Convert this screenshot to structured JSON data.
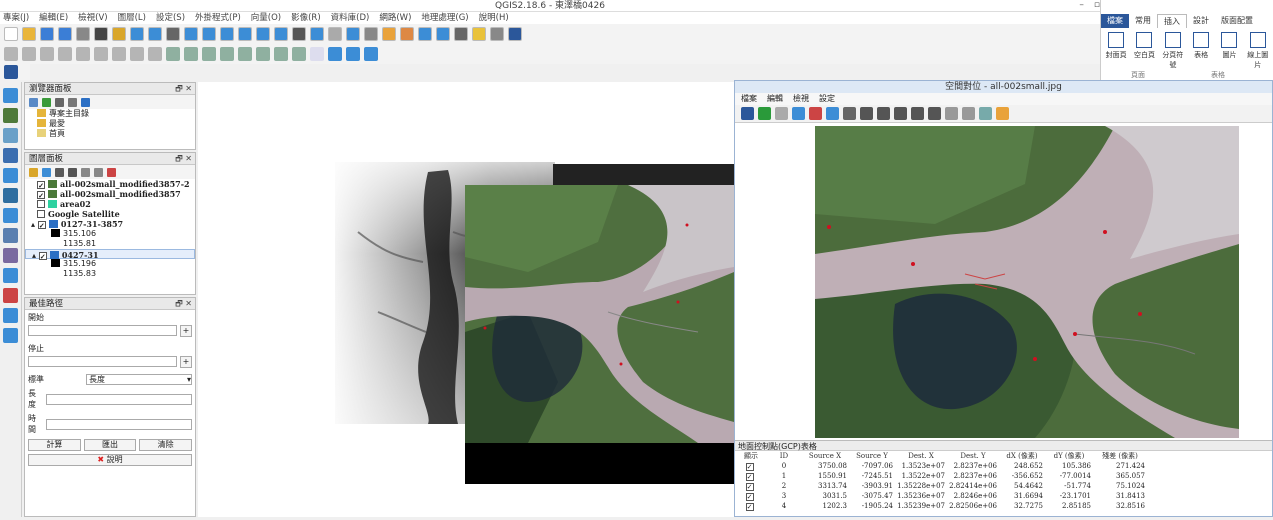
{
  "window": {
    "title": "QGIS2.18.6 - 東澤橋0426"
  },
  "menubar": [
    "專案(J)",
    "編輯(E)",
    "檢視(V)",
    "圖層(L)",
    "設定(S)",
    "外掛程式(P)",
    "向量(O)",
    "影像(R)",
    "資料庫(D)",
    "網路(W)",
    "地理處理(G)",
    "說明(H)"
  ],
  "browser_panel": {
    "title": "瀏覽器面板",
    "items": [
      "專案主目錄",
      "最愛",
      "首頁"
    ]
  },
  "layers_panel": {
    "title": "圖層面板",
    "layers": [
      {
        "name": "all-002small_modified3857-2",
        "checked": "✓"
      },
      {
        "name": "all-002small_modified3857",
        "checked": "✓"
      },
      {
        "name": "area02",
        "checked": ""
      },
      {
        "name": "Google Satellite",
        "checked": ""
      },
      {
        "name": "0127-31-3857",
        "checked": "✓"
      },
      {
        "name": "0427-31",
        "checked": "✓"
      }
    ],
    "legend_values": [
      "315.106",
      "1135.81",
      "315.196",
      "1135.83"
    ]
  },
  "measure_panel": {
    "title": "最佳路徑",
    "start_label": "開始",
    "stop_label": "停止",
    "criterion_label": "標準",
    "criterion_value": "長度",
    "length_label": "長度",
    "time_label": "時間",
    "buttons": [
      "計算",
      "匯出",
      "清除"
    ],
    "help_label": "說明"
  },
  "ribbon": {
    "tabs": [
      "檔案",
      "常用",
      "插入",
      "設計",
      "版面配置"
    ],
    "items": [
      "封面頁",
      "空白頁",
      "分頁符號",
      "表格",
      "圖片",
      "線上圖片"
    ],
    "group_labels": [
      "頁面",
      "表格"
    ]
  },
  "georeferencer": {
    "title": "空間對位 - all-002small.jpg",
    "menu": [
      "檔案",
      "編輯",
      "檢視",
      "設定"
    ],
    "table_title": "地面控制點(GCP)表格",
    "columns": [
      "顯示",
      "ID",
      "Source X",
      "Source Y",
      "Dest. X",
      "Dest. Y",
      "dX (像素)",
      "dY (像素)",
      "殘差 (像素)"
    ],
    "rows": [
      {
        "show": "✓",
        "id": "0",
        "sx": "3750.08",
        "sy": "-7097.06",
        "dx": "1.3523e+07",
        "dy": "2.8237e+06",
        "ex": "248.652",
        "ey": "105.386",
        "res": "271.424"
      },
      {
        "show": "✓",
        "id": "1",
        "sx": "1550.91",
        "sy": "-7245.51",
        "dx": "1.3522e+07",
        "dy": "2.8237e+06",
        "ex": "-356.652",
        "ey": "-77.0014",
        "res": "365.057"
      },
      {
        "show": "✓",
        "id": "2",
        "sx": "3313.74",
        "sy": "-3903.91",
        "dx": "1.35228e+07",
        "dy": "2.82414e+06",
        "ex": "54.4642",
        "ey": "-51.774",
        "res": "75.1024"
      },
      {
        "show": "✓",
        "id": "3",
        "sx": "3031.5",
        "sy": "-3075.47",
        "dx": "1.35236e+07",
        "dy": "2.8246e+06",
        "ex": "31.6694",
        "ey": "-23.1701",
        "res": "31.8413"
      },
      {
        "show": "✓",
        "id": "4",
        "sx": "1202.3",
        "sy": "-1905.24",
        "dx": "1.35239e+07",
        "dy": "2.82506e+06",
        "ex": "32.7275",
        "ey": "2.85185",
        "res": "32.8516"
      }
    ]
  },
  "colors": {
    "accent": "#2b579a",
    "gcp_marker": "#d01020"
  }
}
